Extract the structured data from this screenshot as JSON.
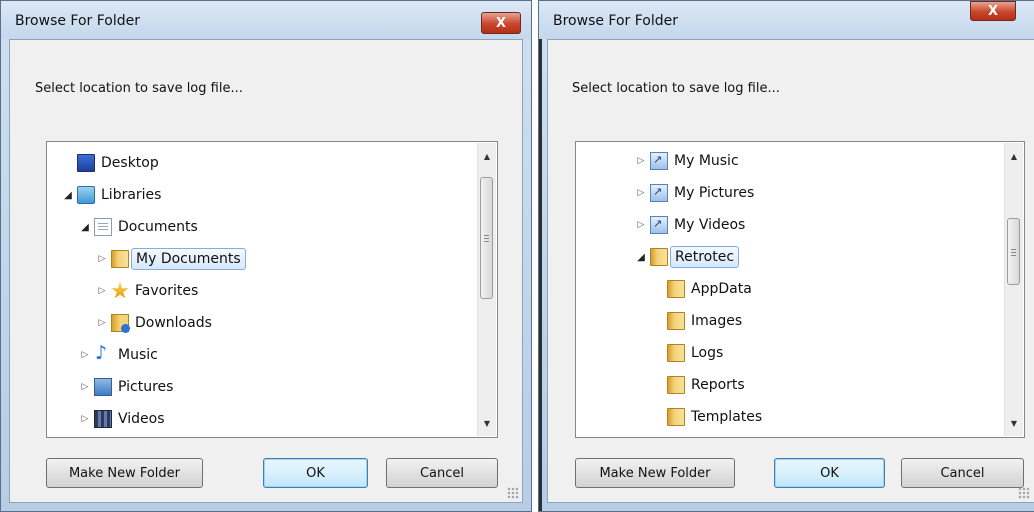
{
  "dialogs": [
    {
      "title": "Browse For Folder",
      "close_label": "X",
      "prompt": "Select location to save log file...",
      "tree": [
        {
          "label": "Desktop",
          "icon": "desktop-icon",
          "level": 0,
          "expander": "none",
          "selected": false
        },
        {
          "label": "Libraries",
          "icon": "library-icon",
          "level": 0,
          "expander": "expanded",
          "selected": false
        },
        {
          "label": "Documents",
          "icon": "document-icon",
          "level": 1,
          "expander": "expanded",
          "selected": false
        },
        {
          "label": "My Documents",
          "icon": "folder-icon",
          "level": 2,
          "expander": "collapsed",
          "selected": true
        },
        {
          "label": "Favorites",
          "icon": "star-folder-icon",
          "level": 2,
          "expander": "collapsed",
          "selected": false
        },
        {
          "label": "Downloads",
          "icon": "download-folder-icon",
          "level": 2,
          "expander": "collapsed",
          "selected": false
        },
        {
          "label": "Music",
          "icon": "music-icon",
          "level": 1,
          "expander": "collapsed",
          "selected": false
        },
        {
          "label": "Pictures",
          "icon": "pictures-icon",
          "level": 1,
          "expander": "collapsed",
          "selected": false
        },
        {
          "label": "Videos",
          "icon": "videos-icon",
          "level": 1,
          "expander": "collapsed",
          "selected": false
        }
      ],
      "buttons": {
        "new_folder": "Make New Folder",
        "ok": "OK",
        "cancel": "Cancel"
      }
    },
    {
      "title": "Browse For Folder",
      "close_label": "X",
      "prompt": "Select location to save log file...",
      "tree": [
        {
          "label": "My Music",
          "icon": "shortcut-icon",
          "level": 0,
          "expander": "collapsed",
          "selected": false
        },
        {
          "label": "My Pictures",
          "icon": "shortcut-icon",
          "level": 0,
          "expander": "collapsed",
          "selected": false
        },
        {
          "label": "My Videos",
          "icon": "shortcut-icon",
          "level": 0,
          "expander": "collapsed",
          "selected": false
        },
        {
          "label": "Retrotec",
          "icon": "folder-icon",
          "level": 0,
          "expander": "expanded",
          "selected": true
        },
        {
          "label": "AppData",
          "icon": "folder-icon",
          "level": 1,
          "expander": "none",
          "selected": false
        },
        {
          "label": "Images",
          "icon": "folder-icon",
          "level": 1,
          "expander": "none",
          "selected": false
        },
        {
          "label": "Logs",
          "icon": "folder-icon",
          "level": 1,
          "expander": "none",
          "selected": false
        },
        {
          "label": "Reports",
          "icon": "folder-icon",
          "level": 1,
          "expander": "none",
          "selected": false
        },
        {
          "label": "Templates",
          "icon": "folder-icon",
          "level": 1,
          "expander": "none",
          "selected": false
        }
      ],
      "buttons": {
        "new_folder": "Make New Folder",
        "ok": "OK",
        "cancel": "Cancel"
      }
    }
  ],
  "scroll_icons": {
    "up": "scroll-up-arrow-icon",
    "down": "scroll-down-arrow-icon"
  },
  "colors": {
    "title_bg": "#c4d7ec",
    "close_red": "#c9452b",
    "selection_border": "#84acdd"
  }
}
